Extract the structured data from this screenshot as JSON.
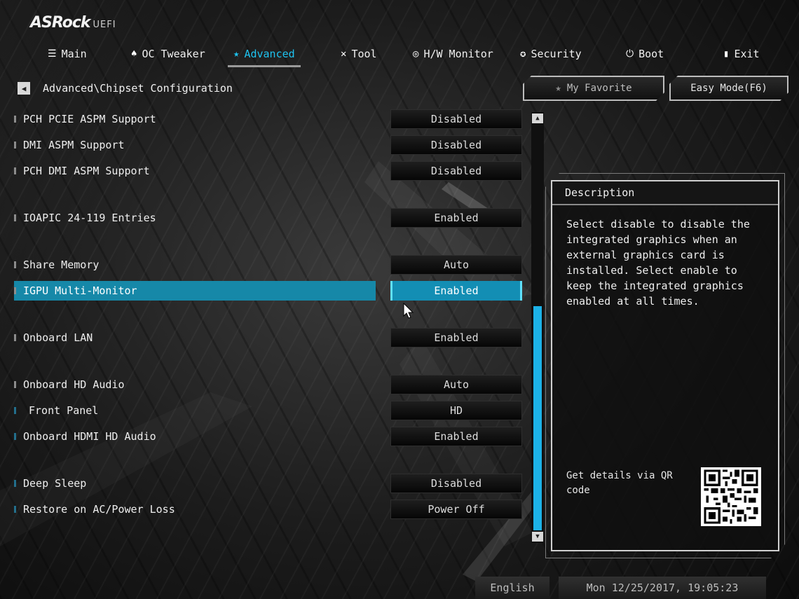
{
  "brand": {
    "name": "ASRock",
    "suffix": "UEFI"
  },
  "nav": {
    "tabs": [
      {
        "label": "Main",
        "icon": "list-icon",
        "glyph": "☰"
      },
      {
        "label": "OC Tweaker",
        "icon": "rocket-icon",
        "glyph": "♠"
      },
      {
        "label": "Advanced",
        "icon": "star-icon",
        "glyph": "★",
        "active": true
      },
      {
        "label": "Tool",
        "icon": "tools-icon",
        "glyph": "✕"
      },
      {
        "label": "H/W Monitor",
        "icon": "monitor-icon",
        "glyph": "◎"
      },
      {
        "label": "Security",
        "icon": "shield-icon",
        "glyph": "✪"
      },
      {
        "label": "Boot",
        "icon": "power-icon",
        "glyph": "⏻"
      },
      {
        "label": "Exit",
        "icon": "exit-icon",
        "glyph": "▮"
      }
    ]
  },
  "breadcrumb": "Advanced\\Chipset Configuration",
  "buttons": {
    "favorite": "My Favorite",
    "easy_mode": "Easy Mode(F6)"
  },
  "settings": [
    {
      "label": "PCH PCIE ASPM Support",
      "value": "Disabled"
    },
    {
      "label": "DMI ASPM Support",
      "value": "Disabled"
    },
    {
      "label": "PCH DMI ASPM Support",
      "value": "Disabled"
    },
    {
      "label": "IOAPIC 24-119 Entries",
      "value": "Enabled"
    },
    {
      "label": "Share Memory",
      "value": "Auto"
    },
    {
      "label": "IGPU Multi-Monitor",
      "value": "Enabled",
      "selected": true
    },
    {
      "label": "Onboard LAN",
      "value": "Enabled"
    },
    {
      "label": "Onboard HD Audio",
      "value": "Auto"
    },
    {
      "label": "Front Panel",
      "value": "HD"
    },
    {
      "label": "Onboard HDMI HD Audio",
      "value": "Enabled"
    },
    {
      "label": "Deep Sleep",
      "value": "Disabled"
    },
    {
      "label": "Restore on AC/Power Loss",
      "value": "Power Off"
    }
  ],
  "description": {
    "title": "Description",
    "text": "Select disable to disable the\nintegrated graphics when an\nexternal graphics card is\ninstalled. Select enable to\nkeep the integrated graphics\nenabled at all times.",
    "qr_text": "Get details via QR\ncode"
  },
  "status": {
    "language": "English",
    "datetime": "Mon 12/25/2017, 19:05:23"
  },
  "colors": {
    "accent": "#1ec3f0",
    "selected_row": "#1688a8",
    "scroll_thumb": "#1cb2e8"
  }
}
